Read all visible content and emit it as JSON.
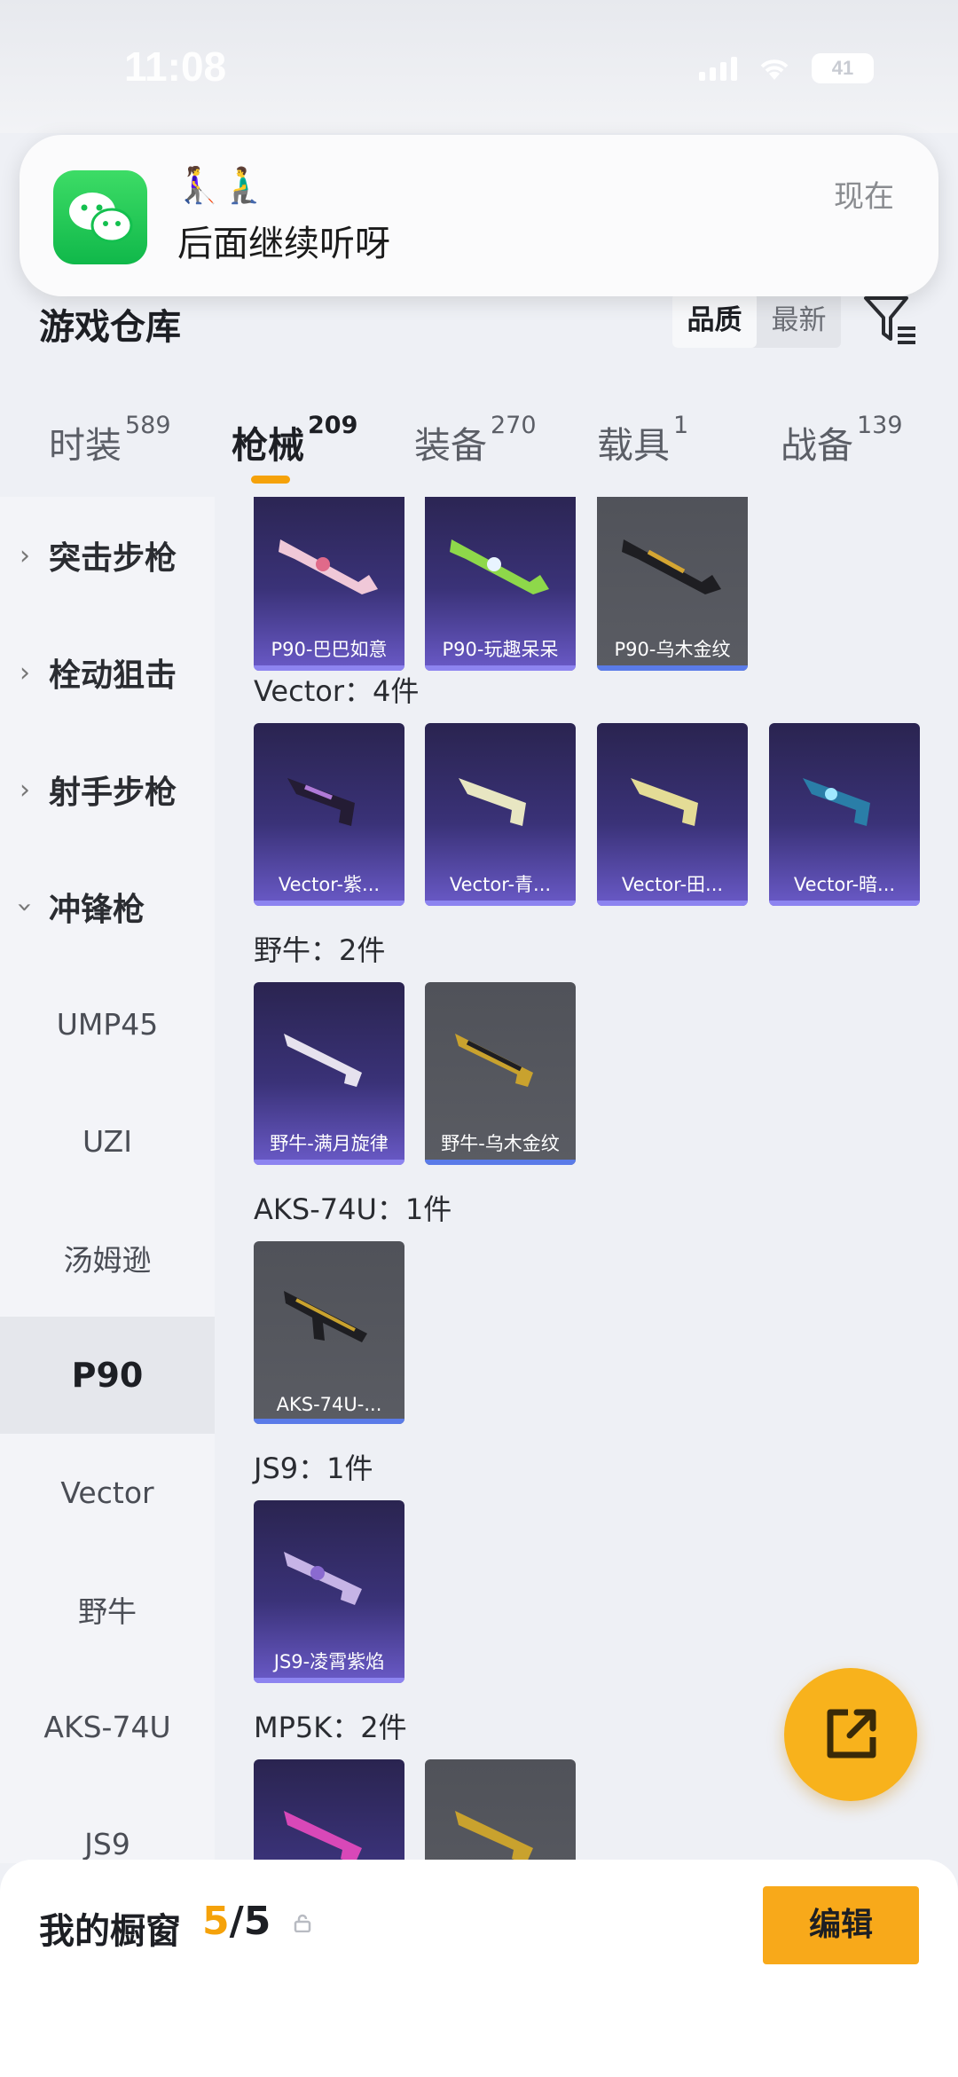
{
  "status": {
    "time": "11:08",
    "battery": "41"
  },
  "notification": {
    "emoji": "👩‍🦯‍➡️🧎‍♂️",
    "message": "后面继续听呀",
    "time": "现在"
  },
  "header": {
    "title": "游戏仓库",
    "sort_quality": "品质",
    "sort_newest": "最新"
  },
  "tabs": [
    {
      "label": "时装",
      "count": "589"
    },
    {
      "label": "枪械",
      "count": "209"
    },
    {
      "label": "装备",
      "count": "270"
    },
    {
      "label": "载具",
      "count": "1"
    },
    {
      "label": "战备",
      "count": "139"
    }
  ],
  "sidebar": {
    "categories": [
      "突击步枪",
      "栓动狙击",
      "射手步枪",
      "冲锋枪"
    ],
    "items": [
      "UMP45",
      "UZI",
      "汤姆逊",
      "P90",
      "Vector",
      "野牛",
      "AKS-74U",
      "JS9"
    ],
    "selected": "P90"
  },
  "groups": [
    {
      "title": "",
      "items": [
        "P90-巴巴如意",
        "P90-玩趣呆呆",
        "P90-乌木金纹"
      ]
    },
    {
      "title": "Vector：4件",
      "items": [
        "Vector-紫...",
        "Vector-青...",
        "Vector-田...",
        "Vector-暗..."
      ]
    },
    {
      "title": "野牛：2件",
      "items": [
        "野牛-满月旋律",
        "野牛-乌木金纹"
      ]
    },
    {
      "title": "AKS-74U：1件",
      "items": [
        "AKS-74U-..."
      ]
    },
    {
      "title": "JS9：1件",
      "items": [
        "JS9-凌霄紫焰"
      ]
    },
    {
      "title": "MP5K：2件",
      "items": [
        "",
        ""
      ]
    }
  ],
  "bottom": {
    "my_window": "我的橱窗",
    "count_used": "5",
    "count_sep": "/5",
    "edit": "编辑"
  },
  "colors": {
    "accent": "#f5a20a",
    "fab": "#f8b21c",
    "purple_card": "#3a3278",
    "gray_card": "#55575e"
  }
}
